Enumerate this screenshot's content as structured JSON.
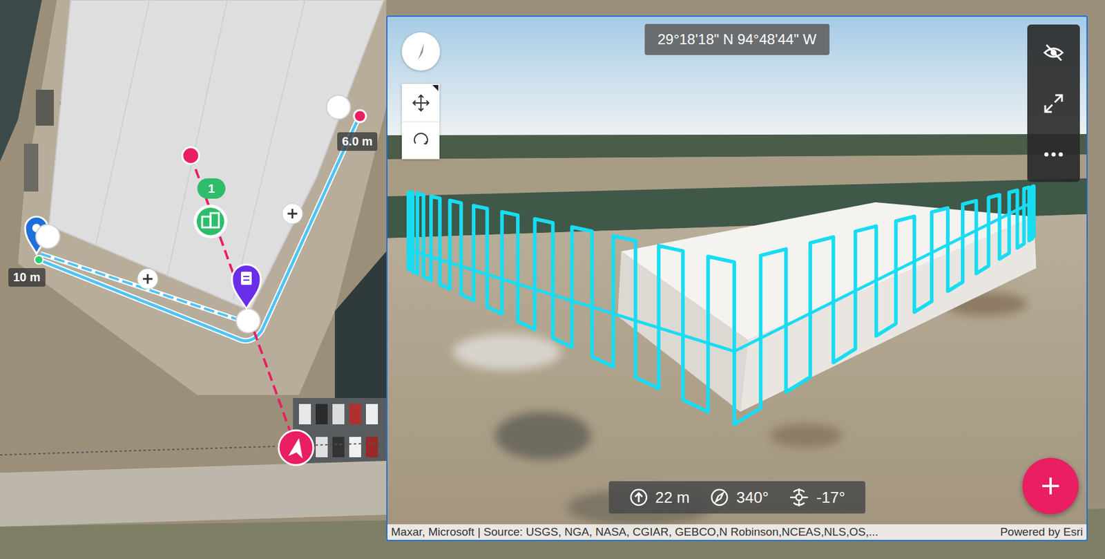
{
  "map": {
    "distance_labels": [
      "10 m",
      "6.0 m"
    ],
    "task_badge": "1"
  },
  "scene_view": {
    "coordinates": "29°18'18\" N 94°48'44\" W",
    "camera": [
      {
        "kind": "altitude",
        "value": "22 m"
      },
      {
        "kind": "heading",
        "value": "340°"
      },
      {
        "kind": "gimbal",
        "value": "-17°"
      }
    ],
    "attribution": "Maxar, Microsoft | Source: USGS, NGA, NASA, CGIAR, GEBCO,N Robinson,NCEAS,NLS,OS,...",
    "powered_by": "Powered by Esri"
  }
}
